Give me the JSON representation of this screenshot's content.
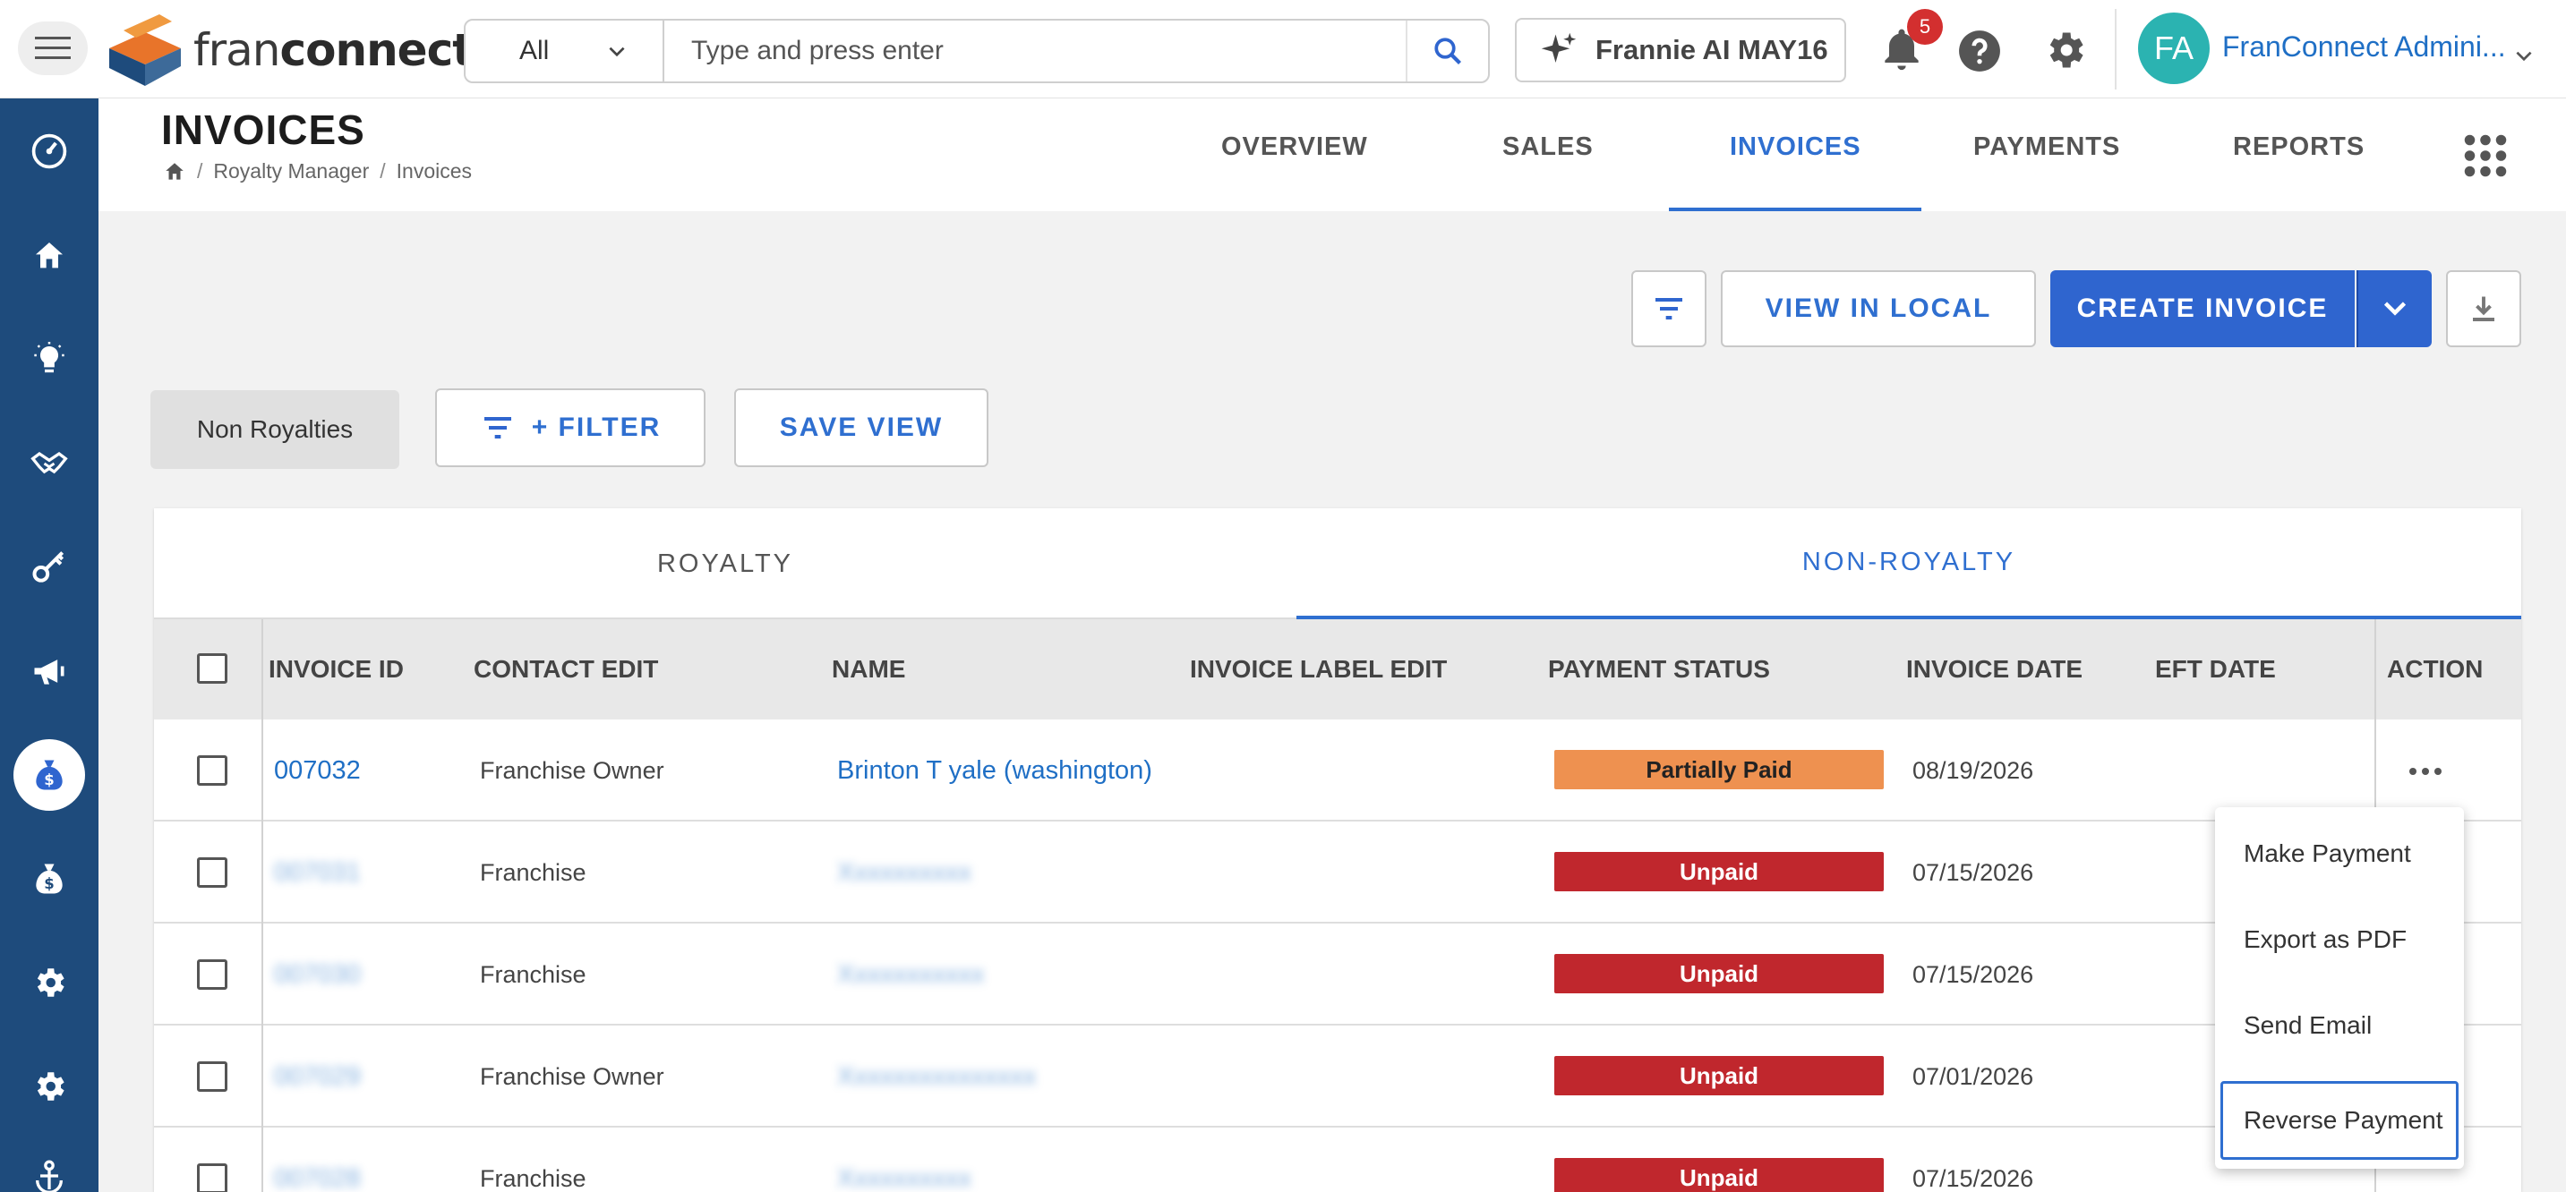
{
  "topbar": {
    "logo": {
      "text_light": "fran",
      "text_bold": "connect"
    },
    "search": {
      "scope": "All",
      "placeholder": "Type and press enter"
    },
    "frannie_label": "Frannie AI MAY16",
    "notification_count": "5",
    "user": {
      "initials": "FA",
      "name": "FranConnect Admini..."
    }
  },
  "page": {
    "title": "INVOICES",
    "breadcrumb": [
      "Royalty Manager",
      "Invoices"
    ],
    "nav_tabs": [
      {
        "label": "OVERVIEW",
        "active": false
      },
      {
        "label": "SALES",
        "active": false
      },
      {
        "label": "INVOICES",
        "active": true
      },
      {
        "label": "PAYMENTS",
        "active": false
      },
      {
        "label": "REPORTS",
        "active": false
      }
    ]
  },
  "toolbar": {
    "view_local_label": "VIEW IN LOCAL",
    "create_invoice_label": "CREATE INVOICE",
    "chip_label": "Non Royalties",
    "filter_label": "+ FILTER",
    "save_view_label": "SAVE VIEW"
  },
  "sub_tabs": [
    {
      "label": "ROYALTY",
      "active": false
    },
    {
      "label": "NON-ROYALTY",
      "active": true
    }
  ],
  "table": {
    "columns": [
      "INVOICE ID",
      "CONTACT EDIT",
      "NAME",
      "INVOICE LABEL EDIT",
      "PAYMENT STATUS",
      "INVOICE DATE",
      "EFT DATE",
      "ACTION"
    ],
    "rows": [
      {
        "invoice_id": "007032",
        "contact": "Franchise Owner",
        "name": "Brinton T yale (washington)",
        "status": "Partially Paid",
        "date": "08/19/2026",
        "redacted": false
      },
      {
        "invoice_id": "007031",
        "contact": "Franchise",
        "name": "Xxxxxxxxxx",
        "status": "Unpaid",
        "date": "07/15/2026",
        "redacted": true
      },
      {
        "invoice_id": "007030",
        "contact": "Franchise",
        "name": "Xxxxxxxxxxx",
        "status": "Unpaid",
        "date": "07/15/2026",
        "redacted": true
      },
      {
        "invoice_id": "007029",
        "contact": "Franchise Owner",
        "name": "Xxxxxxxxxxxxxxx",
        "status": "Unpaid",
        "date": "07/01/2026",
        "redacted": true
      },
      {
        "invoice_id": "007028",
        "contact": "Franchise",
        "name": "Xxxxxxxxxx",
        "status": "Unpaid",
        "date": "07/15/2026",
        "redacted": true
      }
    ]
  },
  "action_menu": {
    "items": [
      "Make Payment",
      "Export as PDF",
      "Send Email",
      "Reverse Payment"
    ],
    "focused_index": 3
  },
  "colors": {
    "primary": "#2f65cf",
    "rail": "#1e4b7c",
    "partially_paid": "#ee9150",
    "unpaid": "#c0272d",
    "avatar": "#2bb3b1"
  }
}
